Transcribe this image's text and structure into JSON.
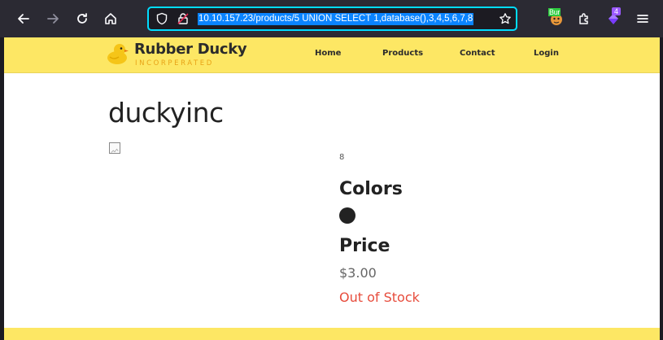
{
  "browser": {
    "url": "10.10.157.23/products/5 UNION SELECT 1,database(),3,4,5,6,7,8",
    "extension_label": "Bur",
    "badge_count": "4",
    "accent": "#00ddff"
  },
  "site": {
    "brand_name": "Rubber Ducky",
    "brand_sub": "INCORPERATED",
    "nav": [
      "Home",
      "Products",
      "Contact",
      "Login"
    ],
    "header_color": "#fde764"
  },
  "product": {
    "title": "duckyinc",
    "stock_number": "8",
    "colors_heading": "Colors",
    "price_heading": "Price",
    "price": "$3.00",
    "stock_status": "Out of Stock",
    "swatch_color": "#222222"
  }
}
